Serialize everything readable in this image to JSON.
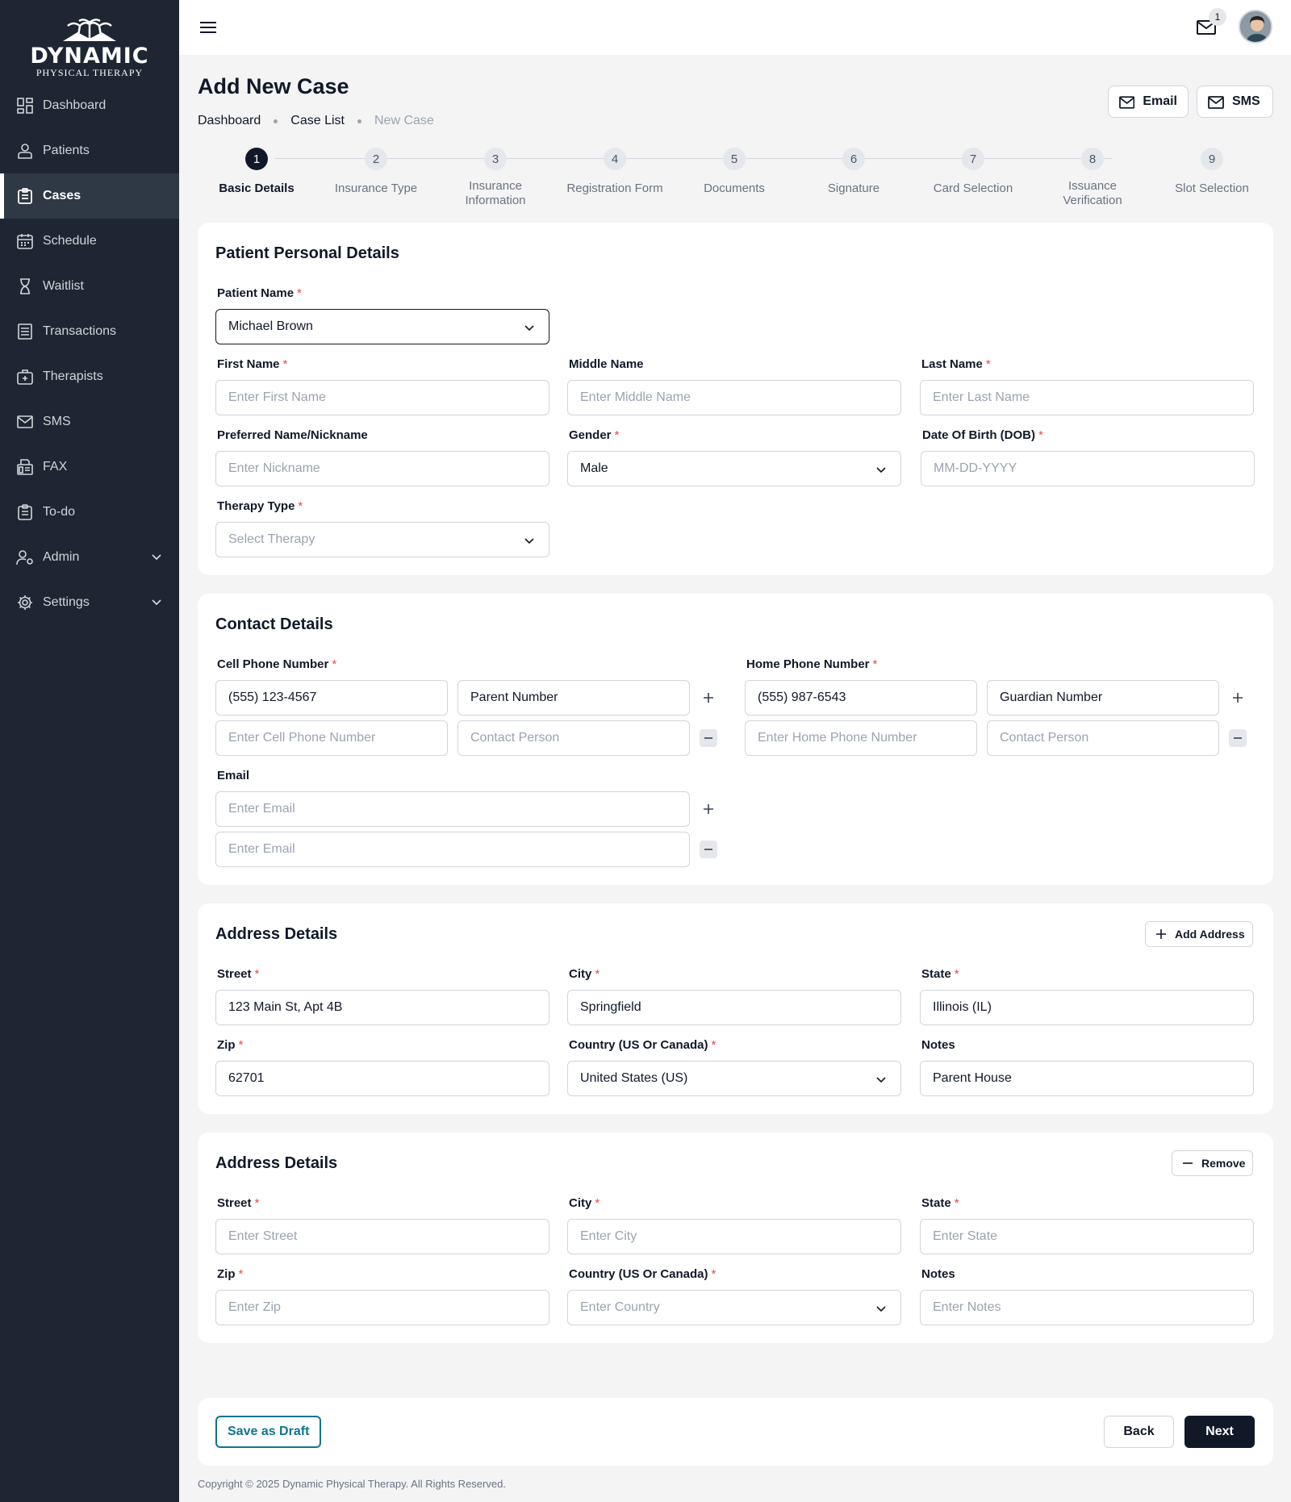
{
  "brand": {
    "line1": "DYNAMIC",
    "line2": "PHYSICAL THERAPY"
  },
  "sidebar": {
    "items": [
      {
        "label": "Dashboard"
      },
      {
        "label": "Patients"
      },
      {
        "label": "Cases"
      },
      {
        "label": "Schedule"
      },
      {
        "label": "Waitlist"
      },
      {
        "label": "Transactions"
      },
      {
        "label": "Therapists"
      },
      {
        "label": "SMS"
      },
      {
        "label": "FAX"
      },
      {
        "label": "To-do"
      },
      {
        "label": "Admin"
      },
      {
        "label": "Settings"
      }
    ]
  },
  "topbar": {
    "notification_count": "1"
  },
  "header": {
    "title": "Add New Case",
    "breadcrumb": [
      "Dashboard",
      "Case List",
      "New Case"
    ],
    "email_label": "Email",
    "sms_label": "SMS"
  },
  "steps": [
    {
      "num": "1",
      "label": "Basic Details"
    },
    {
      "num": "2",
      "label": "Insurance Type"
    },
    {
      "num": "3",
      "label": "Insurance Information"
    },
    {
      "num": "4",
      "label": "Registration Form"
    },
    {
      "num": "5",
      "label": "Documents"
    },
    {
      "num": "6",
      "label": "Signature"
    },
    {
      "num": "7",
      "label": "Card Selection"
    },
    {
      "num": "8",
      "label": "Issuance Verification"
    },
    {
      "num": "9",
      "label": "Slot Selection"
    }
  ],
  "personal": {
    "title": "Patient Personal Details",
    "patient_name_label": "Patient Name",
    "patient_name_value": "Michael Brown",
    "first_name_label": "First Name",
    "first_name_ph": "Enter First Name",
    "middle_name_label": "Middle Name",
    "middle_name_ph": "Enter Middle Name",
    "last_name_label": "Last Name",
    "last_name_ph": "Enter Last Name",
    "nickname_label": "Preferred Name/Nickname",
    "nickname_ph": "Enter Nickname",
    "gender_label": "Gender",
    "gender_value": "Male",
    "dob_label": "Date Of Birth (DOB)",
    "dob_ph": "MM-DD-YYYY",
    "therapy_label": "Therapy Type",
    "therapy_ph": "Select Therapy"
  },
  "contact": {
    "title": "Contact Details",
    "cell_label": "Cell Phone Number",
    "cell_value": "(555) 123-4567",
    "cell_rel_value": "Parent Number",
    "cell_ph": "Enter Cell Phone Number",
    "contact_person_ph": "Contact Person",
    "home_label": "Home Phone Number",
    "home_value": "(555) 987-6543",
    "home_rel_value": "Guardian Number",
    "home_ph": "Enter Home Phone Number",
    "email_label": "Email",
    "email_ph": "Enter Email"
  },
  "address1": {
    "title": "Address Details",
    "add_label": "Add Address",
    "street_label": "Street",
    "street_value": "123 Main St, Apt 4B",
    "city_label": "City",
    "city_value": "Springfield",
    "state_label": "State",
    "state_value": "Illinois (IL)",
    "zip_label": "Zip",
    "zip_value": "62701",
    "country_label": "Country (US Or Canada)",
    "country_value": "United States (US)",
    "notes_label": "Notes",
    "notes_value": "Parent House"
  },
  "address2": {
    "title": "Address Details",
    "remove_label": "Remove",
    "street_label": "Street",
    "street_ph": "Enter Street",
    "city_label": "City",
    "city_ph": "Enter City",
    "state_label": "State",
    "state_ph": "Enter State",
    "zip_label": "Zip",
    "zip_ph": "Enter Zip",
    "country_label": "Country (US Or Canada)",
    "country_ph": "Enter Country",
    "notes_label": "Notes",
    "notes_ph": "Enter Notes"
  },
  "actions": {
    "draft": "Save as Draft",
    "back": "Back",
    "next": "Next"
  },
  "footer": {
    "copyright": "Copyright © 2025 Dynamic Physical Therapy. All Rights Reserved."
  },
  "colors": {
    "sidebar_bg": "#1e2633",
    "primary": "#111827",
    "draft_accent": "#0e7490",
    "required": "#ef4444"
  }
}
